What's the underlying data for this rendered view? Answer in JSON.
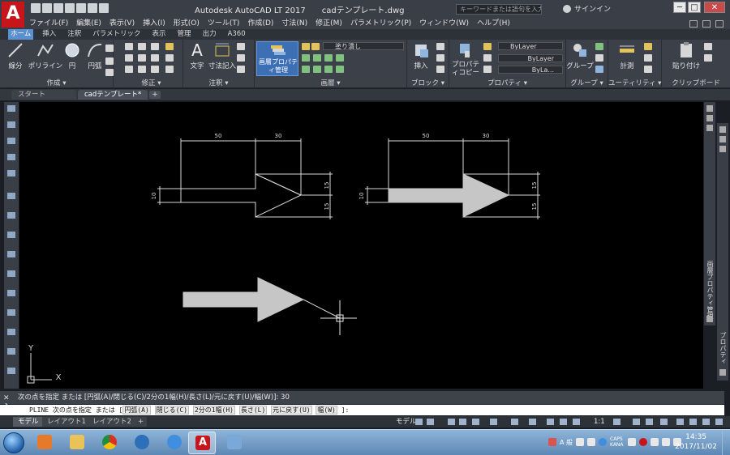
{
  "window": {
    "title": "Autodesk AutoCAD LT 2017　　cadテンプレート.dwg",
    "search_placeholder": "キーワードまたは語句を入力",
    "signin": "サインイン",
    "controls": {
      "minimize": "─",
      "maximize": "□",
      "close": "✕"
    }
  },
  "menu": [
    "ファイル(F)",
    "編集(E)",
    "表示(V)",
    "挿入(I)",
    "形式(O)",
    "ツール(T)",
    "作成(D)",
    "寸法(N)",
    "修正(M)",
    "パラメトリック(P)",
    "ウィンドウ(W)",
    "ヘルプ(H)"
  ],
  "ribbon_tabs": [
    "ホーム",
    "挿入",
    "注釈",
    "パラメトリック",
    "表示",
    "管理",
    "出力",
    "A360"
  ],
  "ribbon": {
    "draw": {
      "line": "線分",
      "polyline": "ポリライン",
      "circle": "円",
      "arc": "円弧",
      "label": "作成 ▾"
    },
    "modify": {
      "label": "修正 ▾"
    },
    "annotation": {
      "text": "文字",
      "dimension": "寸法記入",
      "label": "注釈 ▾"
    },
    "layers": {
      "layer_properties": "画層プロパティ管理",
      "layer_state": "塗り潰し",
      "label": "画層 ▾"
    },
    "block": {
      "insert": "挿入",
      "label": "ブロック ▾"
    },
    "properties": {
      "match": "プロパティコピー",
      "color": "ByLayer",
      "linetype": "ByLayer",
      "lineweight": "ByLa...",
      "label": "プロパティ ▾"
    },
    "groups": {
      "group": "グループ",
      "label": "グループ ▾"
    },
    "utilities": {
      "measure": "計測",
      "label": "ユーティリティ ▾"
    },
    "clipboard": {
      "paste": "貼り付け",
      "label": "クリップボード"
    }
  },
  "file_tabs": [
    "スタート",
    "cadテンプレート*"
  ],
  "drawing": {
    "dim_top_left": "50",
    "dim_top_right": "30",
    "dim_left": "10",
    "dim_right_upper": "15",
    "dim_right_lower": "15",
    "ucs_x": "X",
    "ucs_y": "Y"
  },
  "right_palette_label": "画層プロパティ管理",
  "right_palette2_label": "プロパティ",
  "command": {
    "history": "次の点を指定 または [円弧(A)/閉じる(C)/2分の1幅(H)/長さ(L)/元に戻す(U)/幅(W)]: 30",
    "prompt_prefix": "PLINE 次の点を指定 または",
    "options": [
      "円弧(A)",
      "閉じる(C)",
      "2分の1幅(H)",
      "長さ(L)",
      "元に戻す(U)",
      "幅(W)"
    ],
    "suffix": "]:"
  },
  "layout_tabs": [
    "モデル",
    "レイアウト1",
    "レイアウト2"
  ],
  "status": {
    "model": "モデル",
    "scale": "1:1"
  },
  "taskbar": {
    "tray_text": "A 般",
    "caps": "CAPS KANA",
    "time": "14:35",
    "date": "2017/11/02"
  }
}
